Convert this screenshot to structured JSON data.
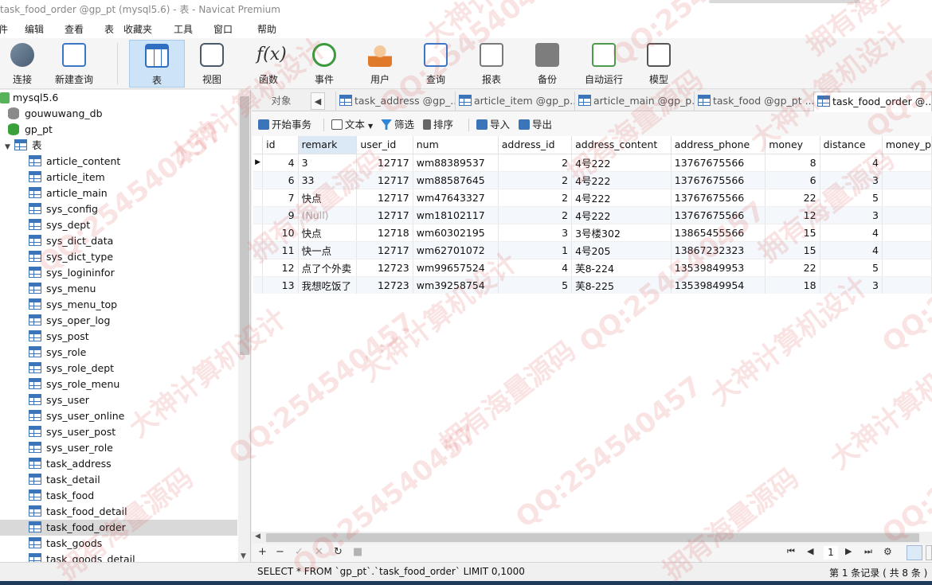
{
  "window": {
    "title": "task_food_order @gp_pt (mysql5.6) - 表 - Navicat Premium"
  },
  "menu": {
    "items": [
      {
        "label": "件",
        "name": "menu-file"
      },
      {
        "label": "编辑",
        "name": "menu-edit"
      },
      {
        "label": "查看",
        "name": "menu-view"
      },
      {
        "label": "表",
        "name": "menu-table"
      },
      {
        "label": "收藏夹",
        "name": "menu-favorites"
      },
      {
        "label": "工具",
        "name": "menu-tools"
      },
      {
        "label": "窗口",
        "name": "menu-window"
      },
      {
        "label": "帮助",
        "name": "menu-help"
      }
    ]
  },
  "toolbar": {
    "tools": [
      {
        "label": "连接",
        "icon": "connect-icon"
      },
      {
        "label": "新建查询",
        "icon": "new-query-icon"
      },
      {
        "label": "表",
        "icon": "table-icon",
        "active": true
      },
      {
        "label": "视图",
        "icon": "view-icon"
      },
      {
        "label": "函数",
        "icon": "function-icon",
        "glyph": "f(x)"
      },
      {
        "label": "事件",
        "icon": "event-clock-icon"
      },
      {
        "label": "用户",
        "icon": "user-icon"
      },
      {
        "label": "查询",
        "icon": "query-icon"
      },
      {
        "label": "报表",
        "icon": "report-icon"
      },
      {
        "label": "备份",
        "icon": "backup-icon"
      },
      {
        "label": "自动运行",
        "icon": "auto-run-icon"
      },
      {
        "label": "模型",
        "icon": "model-icon"
      }
    ]
  },
  "sidebar": {
    "connection": "mysql5.6",
    "databases": [
      {
        "label": "gouwuwang_db"
      },
      {
        "label": "gp_pt"
      }
    ],
    "tables_folder": "表",
    "tables": [
      "article_content",
      "article_item",
      "article_main",
      "sys_config",
      "sys_dept",
      "sys_dict_data",
      "sys_dict_type",
      "sys_logininfor",
      "sys_menu",
      "sys_menu_top",
      "sys_oper_log",
      "sys_post",
      "sys_role",
      "sys_role_dept",
      "sys_role_menu",
      "sys_user",
      "sys_user_online",
      "sys_user_post",
      "sys_user_role",
      "task_address",
      "task_detail",
      "task_food",
      "task_food_detail",
      "task_food_order",
      "task_goods",
      "task_goods_detail"
    ],
    "selected_table": "task_food_order"
  },
  "tabs": {
    "object_tab": "对象",
    "items": [
      {
        "label": "task_address @gp_..."
      },
      {
        "label": "article_item @gp_p..."
      },
      {
        "label": "article_main @gp_p..."
      },
      {
        "label": "task_food @gp_pt ..."
      },
      {
        "label": "task_food_order @...",
        "active": true
      }
    ]
  },
  "actions": {
    "begin_transaction": "开始事务",
    "text": "文本",
    "filter": "筛选",
    "sort": "排序",
    "import": "导入",
    "export": "导出"
  },
  "grid": {
    "columns": [
      "id",
      "remark",
      "user_id",
      "num",
      "address_id",
      "address_content",
      "address_phone",
      "money",
      "distance",
      "money_p"
    ],
    "rows": [
      [
        "4",
        "3",
        "12717",
        "wm88389537",
        "2",
        "4号222",
        "13767675566",
        "8",
        "4",
        ""
      ],
      [
        "6",
        "33",
        "12717",
        "wm88587645",
        "2",
        "4号222",
        "13767675566",
        "6",
        "3",
        ""
      ],
      [
        "7",
        "快点",
        "12717",
        "wm47643327",
        "2",
        "4号222",
        "13767675566",
        "22",
        "5",
        ""
      ],
      [
        "9",
        "(Null)",
        "12717",
        "wm18102117",
        "2",
        "4号222",
        "13767675566",
        "12",
        "3",
        ""
      ],
      [
        "10",
        "快点",
        "12718",
        "wm60302195",
        "3",
        "3号楼302",
        "13865455566",
        "15",
        "4",
        ""
      ],
      [
        "11",
        "快一点",
        "12717",
        "wm62701072",
        "1",
        "4号205",
        "13867232323",
        "15",
        "4",
        ""
      ],
      [
        "12",
        "点了个外卖",
        "12723",
        "wm99657524",
        "4",
        "芙8-224",
        "13539849953",
        "22",
        "5",
        ""
      ],
      [
        "13",
        "我想吃饭了",
        "12723",
        "wm39258754",
        "5",
        "芙8-225",
        "13539849954",
        "18",
        "3",
        ""
      ]
    ]
  },
  "navigation": {
    "page": "1"
  },
  "status": {
    "sql": "SELECT * FROM `gp_pt`.`task_food_order` LIMIT 0,1000",
    "record_info": "第 1 条记录 ( 共 8 条 ) "
  },
  "watermark": {
    "texts": [
      "QQ:254540457",
      "大神计算机设计",
      "拥有海量源码"
    ]
  }
}
